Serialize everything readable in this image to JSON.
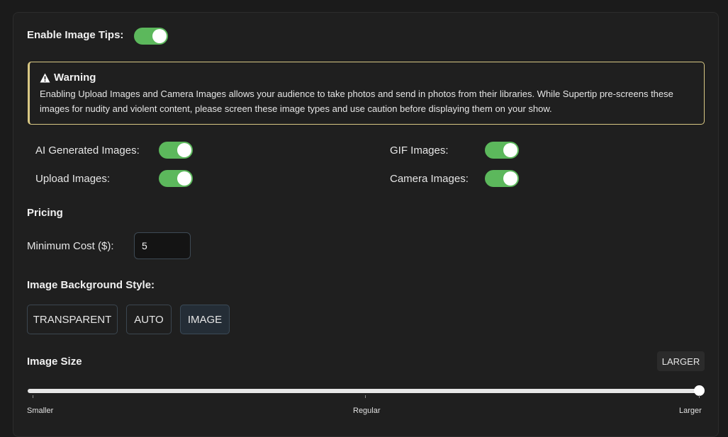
{
  "image_tips": {
    "label": "Enable Image Tips:",
    "enabled": true
  },
  "warning": {
    "title": "Warning",
    "text": "Enabling Upload Images and Camera Images allows your audience to take photos and send in photos from their libraries. While Supertip pre-screens these images for nudity and violent content, please screen these image types and use caution before displaying them on your show.",
    "accent_color": "#d9c884"
  },
  "image_types": [
    {
      "label": "AI Generated Images:",
      "enabled": true
    },
    {
      "label": "GIF Images:",
      "enabled": true
    },
    {
      "label": "Upload Images:",
      "enabled": true
    },
    {
      "label": "Camera Images:",
      "enabled": true
    }
  ],
  "pricing": {
    "heading": "Pricing",
    "min_cost_label": "Minimum Cost ($):",
    "min_cost_value": "5"
  },
  "background_style": {
    "heading": "Image Background Style:",
    "options": [
      "TRANSPARENT",
      "AUTO",
      "IMAGE"
    ],
    "selected": "IMAGE"
  },
  "image_size": {
    "heading": "Image Size",
    "current_badge": "LARGER",
    "slider_value": 1.0,
    "ticks": [
      "Smaller",
      "Regular",
      "Larger"
    ]
  },
  "colors": {
    "toggle_on": "#5cb85c",
    "background": "#1b1b1b",
    "panel": "#1f1f1f"
  }
}
